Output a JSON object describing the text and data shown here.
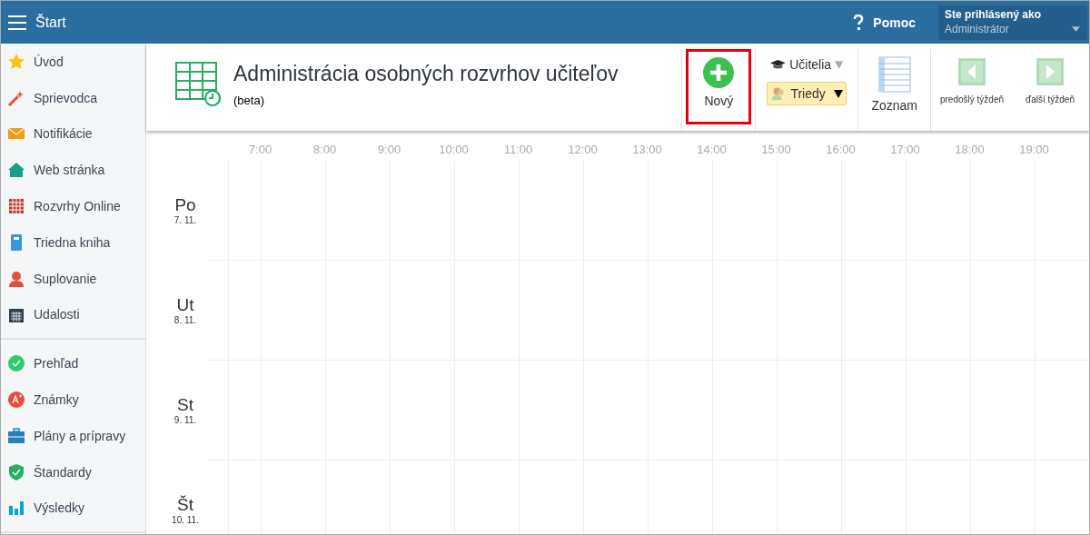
{
  "topbar": {
    "title": "Štart",
    "help": "Pomoc",
    "user_label": "Ste prihlásený ako",
    "user_name": "Administrátor"
  },
  "sidebar": {
    "groups": [
      {
        "items": [
          {
            "label": "Úvod",
            "kind": "star"
          },
          {
            "label": "Sprievodca",
            "kind": "wand"
          },
          {
            "label": "Notifikácie",
            "kind": "mail"
          },
          {
            "label": "Web stránka",
            "kind": "house"
          },
          {
            "label": "Rozvrhy Online",
            "kind": "grid"
          },
          {
            "label": "Triedna kniha",
            "kind": "book"
          },
          {
            "label": "Suplovanie",
            "kind": "person"
          },
          {
            "label": "Udalosti",
            "kind": "calendar"
          }
        ]
      },
      {
        "items": [
          {
            "label": "Prehľad",
            "kind": "check"
          },
          {
            "label": "Známky",
            "kind": "grade"
          },
          {
            "label": "Plány a prípravy",
            "kind": "briefcase"
          },
          {
            "label": "Štandardy",
            "kind": "shield"
          },
          {
            "label": "Výsledky",
            "kind": "bars"
          }
        ]
      }
    ]
  },
  "header": {
    "title": "Administrácia osobných rozvrhov učiteľov",
    "subtitle": "(beta)"
  },
  "toolbar": {
    "new_button": {
      "label": "Nový",
      "highlighted": true
    },
    "view_options": [
      {
        "label": "Učitelia",
        "selected": false
      },
      {
        "label": "Triedy",
        "selected": true
      }
    ],
    "list_button": "Zoznam",
    "prev_week": "predošlý týždeň",
    "next_week": "ďalší týždeň"
  },
  "schedule": {
    "hours": [
      "7:00",
      "8:00",
      "9:00",
      "10:00",
      "11:00",
      "12:00",
      "13:00",
      "14:00",
      "15:00",
      "16:00",
      "17:00",
      "18:00",
      "19:00"
    ],
    "days": [
      {
        "name": "Po",
        "date": "7. 11."
      },
      {
        "name": "Ut",
        "date": "8. 11."
      },
      {
        "name": "St",
        "date": "9. 11."
      },
      {
        "name": "Št",
        "date": "10. 11."
      }
    ]
  }
}
